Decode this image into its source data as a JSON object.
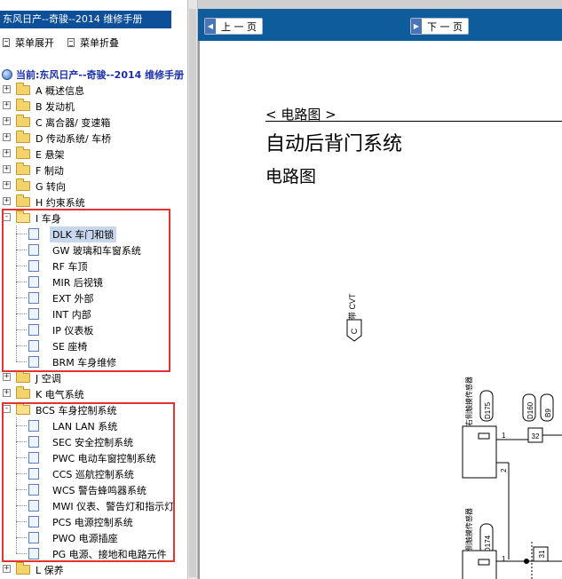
{
  "app": {
    "title": "东风日产--奇骏--2014 维修手册"
  },
  "menu": {
    "expand_label": "菜单展开",
    "collapse_label": "菜单折叠"
  },
  "tree": {
    "root_label": "当前:东风日产--奇骏--2014 维修手册",
    "sections": [
      {
        "label": "A 概述信息"
      },
      {
        "label": "B 发动机"
      },
      {
        "label": "C 离合器/ 变速箱"
      },
      {
        "label": "D 传动系统/ 车桥"
      },
      {
        "label": "E 悬架"
      },
      {
        "label": "F 制动"
      },
      {
        "label": "G 转向"
      },
      {
        "label": "H 约束系统"
      },
      {
        "label": "I 车身",
        "children": [
          "DLK 车门和锁",
          "GW 玻璃和车窗系统",
          "RF 车顶",
          "MIR 后视镜",
          "EXT 外部",
          "INT 内部",
          "IP 仪表板",
          "SE 座椅",
          "BRM 车身维修"
        ]
      },
      {
        "label": "J 空调"
      },
      {
        "label": "K 电气系统"
      },
      {
        "label": "BCS 车身控制系统",
        "children": [
          "LAN LAN 系统",
          "SEC 安全控制系统",
          "PWC 电动车窗控制系统",
          "CCS 巡航控制系统",
          "WCS 警告蜂鸣器系统",
          "MWI 仪表、警告灯和指示灯",
          "PCS 电源控制系统",
          "PWO 电源插座",
          "PG 电源、接地和电路元件"
        ]
      },
      {
        "label": "L 保养"
      }
    ],
    "selected": "DLK 车门和锁"
  },
  "toolbar": {
    "prev_label": "上 一 页",
    "next_label": "下 一 页"
  },
  "document": {
    "section_tag": "< 电路图 >",
    "title": "自动后背门系统",
    "subtitle": "电路图"
  },
  "diagram": {
    "cvt_label": "带 CVT",
    "cvt_tag": "C",
    "sensor1_label": "右侧触摸传感器",
    "sensor1_code": "D175",
    "sensor2_label": "左侧触摸传感器",
    "sensor2_code": "D174",
    "connector_d160": "D160",
    "connector_b9": "B9",
    "pin_1": "1",
    "pin_2": "2",
    "wire_32": "32",
    "wire_31": "31"
  },
  "colors": {
    "title_bar": "#0e4f99",
    "toolbar": "#0f5c9c",
    "root_label": "#1c2fb0",
    "highlight_box": "#e33232"
  }
}
